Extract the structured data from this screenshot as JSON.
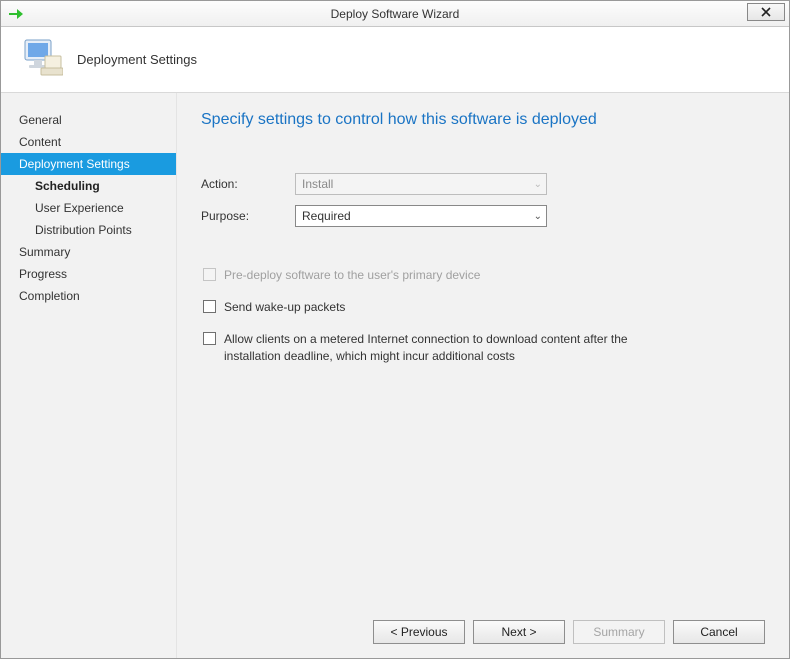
{
  "window": {
    "title": "Deploy Software Wizard"
  },
  "header": {
    "heading": "Deployment Settings"
  },
  "sidebar": {
    "items": [
      {
        "label": "General"
      },
      {
        "label": "Content"
      },
      {
        "label": "Deployment Settings"
      },
      {
        "label": "Scheduling"
      },
      {
        "label": "User Experience"
      },
      {
        "label": "Distribution Points"
      },
      {
        "label": "Summary"
      },
      {
        "label": "Progress"
      },
      {
        "label": "Completion"
      }
    ]
  },
  "main": {
    "title": "Specify settings to control how this software is deployed",
    "action_label": "Action:",
    "action_value": "Install",
    "purpose_label": "Purpose:",
    "purpose_value": "Required",
    "cb_predeploy": "Pre-deploy software to the user's primary device",
    "cb_wakeup": "Send wake-up packets",
    "cb_metered": "Allow clients on a metered Internet connection to download content after the installation deadline, which might incur additional costs"
  },
  "footer": {
    "previous": "< Previous",
    "next": "Next >",
    "summary": "Summary",
    "cancel": "Cancel"
  }
}
